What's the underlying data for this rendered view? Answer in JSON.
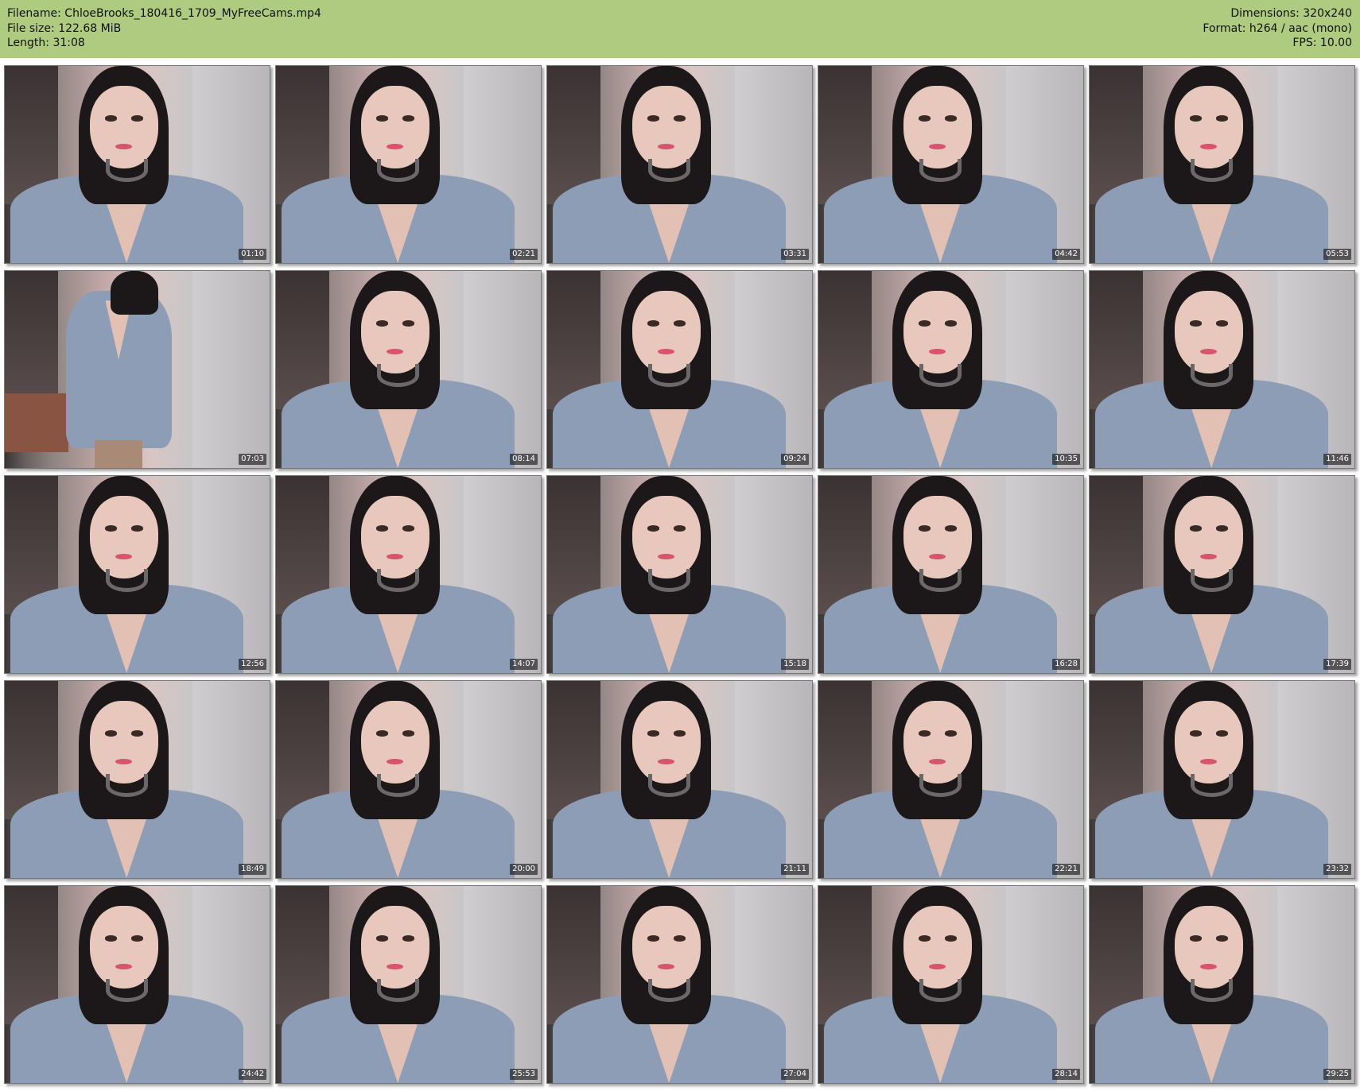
{
  "header": {
    "filename": "Filename: ChloeBrooks_180416_1709_MyFreeCams.mp4",
    "file_size": "File size: 122.68 MiB",
    "length": "Length: 31:08",
    "dimensions": "Dimensions: 320x240",
    "format": "Format: h264 / aac (mono)",
    "fps": "FPS: 10.00",
    "background_color": "#aecb80"
  },
  "frames": [
    {
      "timestamp": "01:10"
    },
    {
      "timestamp": "02:21"
    },
    {
      "timestamp": "03:31"
    },
    {
      "timestamp": "04:42"
    },
    {
      "timestamp": "05:53"
    },
    {
      "timestamp": "07:03"
    },
    {
      "timestamp": "08:14"
    },
    {
      "timestamp": "09:24"
    },
    {
      "timestamp": "10:35"
    },
    {
      "timestamp": "11:46"
    },
    {
      "timestamp": "12:56"
    },
    {
      "timestamp": "14:07"
    },
    {
      "timestamp": "15:18"
    },
    {
      "timestamp": "16:28"
    },
    {
      "timestamp": "17:39"
    },
    {
      "timestamp": "18:49"
    },
    {
      "timestamp": "20:00"
    },
    {
      "timestamp": "21:11"
    },
    {
      "timestamp": "22:21"
    },
    {
      "timestamp": "23:32"
    },
    {
      "timestamp": "24:42"
    },
    {
      "timestamp": "25:53"
    },
    {
      "timestamp": "27:04"
    },
    {
      "timestamp": "28:14"
    },
    {
      "timestamp": "29:25"
    }
  ]
}
